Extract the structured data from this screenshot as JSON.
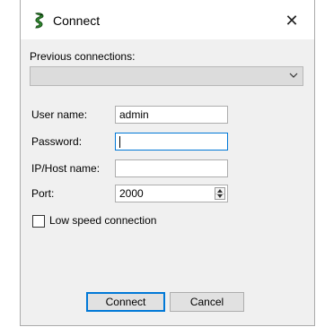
{
  "window": {
    "title": "Connect",
    "icon": "gecko-icon",
    "close_glyph": "✕"
  },
  "previous_connections": {
    "label": "Previous connections:",
    "value": ""
  },
  "form": {
    "username_label": "User name:",
    "username_value": "admin",
    "password_label": "Password:",
    "password_value": "",
    "host_label": "IP/Host name:",
    "host_value": "",
    "port_label": "Port:",
    "port_value": "2000"
  },
  "low_speed": {
    "label": "Low speed connection",
    "checked": false
  },
  "buttons": {
    "connect_label": "Connect",
    "cancel_label": "Cancel"
  },
  "colors": {
    "focus_accent": "#0078d7",
    "dialog_background": "#f0f0f0",
    "icon_green": "#2e8b2e"
  }
}
